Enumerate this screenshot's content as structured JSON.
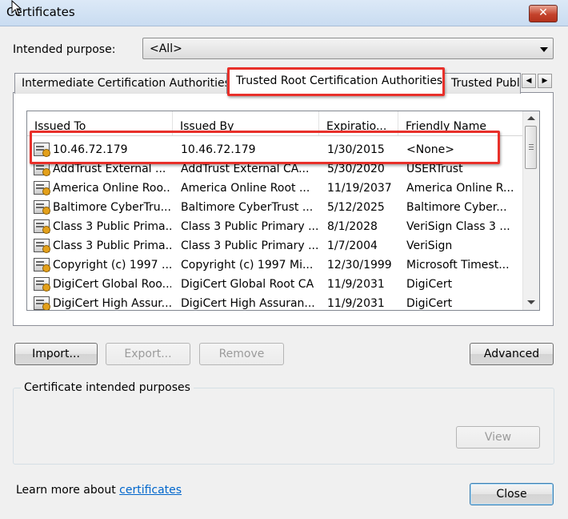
{
  "window": {
    "title": "Certificates",
    "close_glyph": "✕"
  },
  "intended_purpose": {
    "label": "Intended purpose:",
    "value": "<All>"
  },
  "tabs": [
    {
      "label": "Intermediate Certification Authorities"
    },
    {
      "label": "Trusted Root Certification Authorities",
      "selected": true
    },
    {
      "label": "Trusted Publ"
    }
  ],
  "tab_scroll": {
    "left_glyph": "◀",
    "right_glyph": "▶"
  },
  "columns": [
    "Issued To",
    "Issued By",
    "Expiratio...",
    "Friendly Name"
  ],
  "rows": [
    {
      "issued_to": "10.46.72.179",
      "issued_by": "10.46.72.179",
      "expiration": "1/30/2015",
      "friendly_name": "<None>"
    },
    {
      "issued_to": "AddTrust External ...",
      "issued_by": "AddTrust External CA...",
      "expiration": "5/30/2020",
      "friendly_name": "USERTrust"
    },
    {
      "issued_to": "America Online Roo...",
      "issued_by": "America Online Root ...",
      "expiration": "11/19/2037",
      "friendly_name": "America Online R..."
    },
    {
      "issued_to": "Baltimore CyberTru...",
      "issued_by": "Baltimore CyberTrust ...",
      "expiration": "5/12/2025",
      "friendly_name": "Baltimore Cyber..."
    },
    {
      "issued_to": "Class 3 Public Prima...",
      "issued_by": "Class 3 Public Primary ...",
      "expiration": "8/1/2028",
      "friendly_name": "VeriSign Class 3 ..."
    },
    {
      "issued_to": "Class 3 Public Prima...",
      "issued_by": "Class 3 Public Primary ...",
      "expiration": "1/7/2004",
      "friendly_name": "VeriSign"
    },
    {
      "issued_to": "Copyright (c) 1997 ...",
      "issued_by": "Copyright (c) 1997 Mi...",
      "expiration": "12/30/1999",
      "friendly_name": "Microsoft Timest..."
    },
    {
      "issued_to": "DigiCert Global Roo...",
      "issued_by": "DigiCert Global Root CA",
      "expiration": "11/9/2031",
      "friendly_name": "DigiCert"
    },
    {
      "issued_to": "DigiCert High Assur...",
      "issued_by": "DigiCert High Assuran...",
      "expiration": "11/9/2031",
      "friendly_name": "DigiCert"
    }
  ],
  "buttons": {
    "import": "Import...",
    "export": "Export...",
    "remove": "Remove",
    "advanced": "Advanced",
    "view": "View",
    "close": "Close"
  },
  "purposes_group": {
    "label": "Certificate intended purposes"
  },
  "footer": {
    "learn_text": "Learn more about ",
    "link_text": "certificates"
  },
  "colors": {
    "highlight_box": "#e8302a",
    "link": "#0066cc",
    "window_bg": "#f0f0f0"
  }
}
